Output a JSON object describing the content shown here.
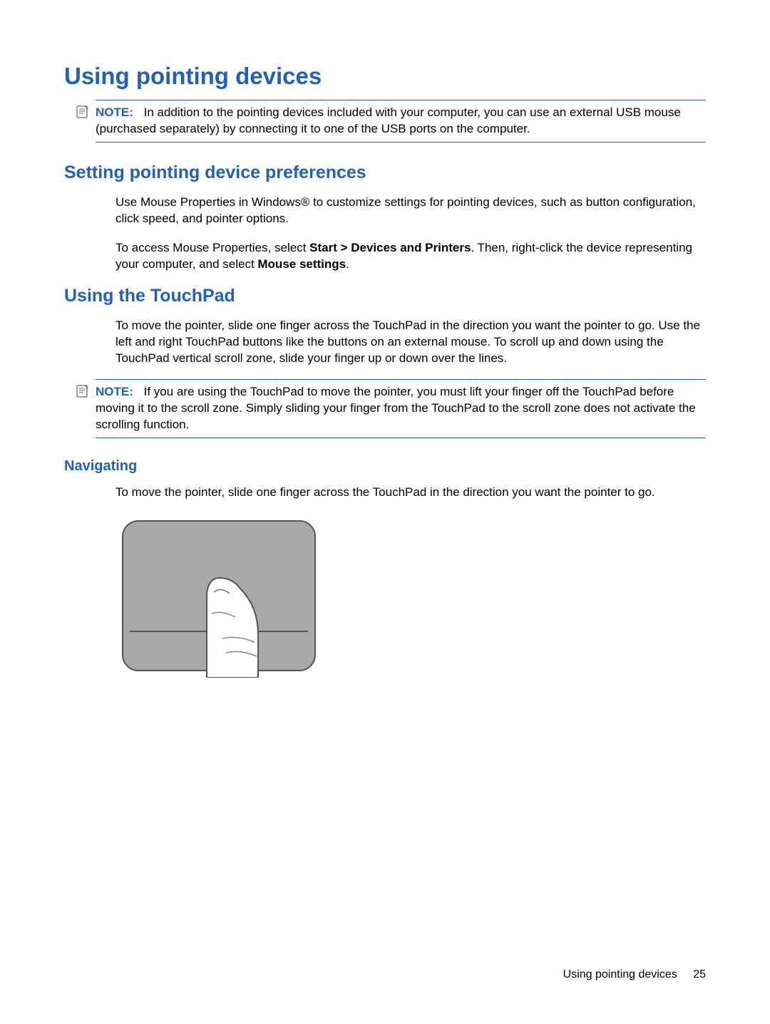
{
  "title": "Using pointing devices",
  "note1": {
    "label": "NOTE:",
    "text": "In addition to the pointing devices included with your computer, you can use an external USB mouse (purchased separately) by connecting it to one of the USB ports on the computer."
  },
  "section1": {
    "title": "Setting pointing device preferences",
    "p1": "Use Mouse Properties in Windows® to customize settings for pointing devices, such as button configuration, click speed, and pointer options.",
    "p2_a": "To access Mouse Properties, select ",
    "p2_bold1": "Start > Devices and Printers",
    "p2_b": ". Then, right-click the device representing your computer, and select ",
    "p2_bold2": "Mouse settings",
    "p2_c": "."
  },
  "section2": {
    "title": "Using the TouchPad",
    "p1": "To move the pointer, slide one finger across the TouchPad in the direction you want the pointer to go. Use the left and right TouchPad buttons like the buttons on an external mouse. To scroll up and down using the TouchPad vertical scroll zone, slide your finger up or down over the lines.",
    "note": {
      "label": "NOTE:",
      "text": "If you are using the TouchPad to move the pointer, you must lift your finger off the TouchPad before moving it to the scroll zone. Simply sliding your finger from the TouchPad to the scroll zone does not activate the scrolling function."
    },
    "sub1": {
      "title": "Navigating",
      "p1": "To move the pointer, slide one finger across the TouchPad in the direction you want the pointer to go."
    }
  },
  "footer": {
    "text": "Using pointing devices",
    "page": "25"
  }
}
